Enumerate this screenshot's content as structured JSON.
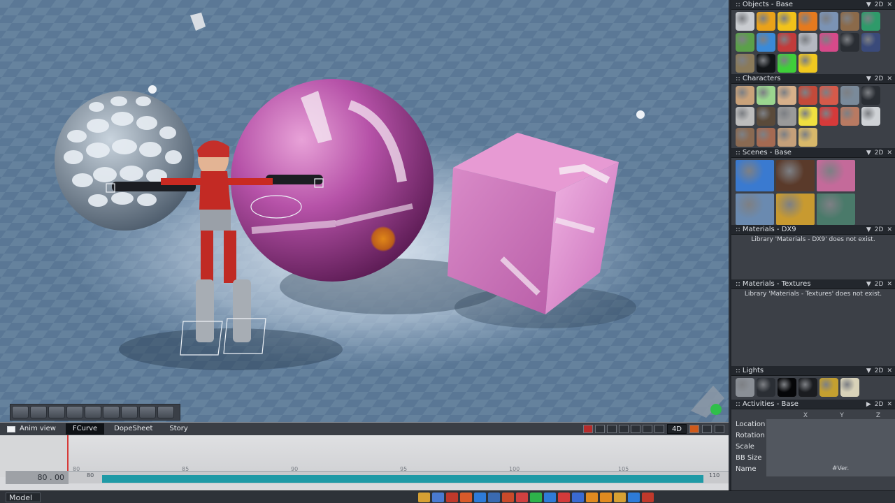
{
  "panels": [
    {
      "title": ":: Objects - Base",
      "controls": [
        "▼",
        "2D",
        "✕"
      ]
    },
    {
      "title": ":: Characters",
      "controls": [
        "▼",
        "2D",
        "✕"
      ]
    },
    {
      "title": ":: Scenes - Base",
      "controls": [
        "▼",
        "2D",
        "✕"
      ]
    },
    {
      "title": ":: Materials - DX9",
      "controls": [
        "▼",
        "2D",
        "✕"
      ],
      "message": "Library 'Materials - DX9' does not exist."
    },
    {
      "title": ":: Materials - Textures",
      "controls": [
        "▼",
        "2D",
        "✕"
      ],
      "message": "Library 'Materials - Textures' does not exist."
    },
    {
      "title": ":: Lights",
      "controls": [
        "▼",
        "2D",
        "✕"
      ]
    },
    {
      "title": ":: Activities - Base",
      "controls": [
        "▶",
        "2D",
        "✕"
      ]
    }
  ],
  "object_colors": [
    "#c9ccd0",
    "#e9a21a",
    "#f2c21a",
    "#e57a1e",
    "#7b93b4",
    "#8b6a4a",
    "#2f9a6a",
    "#5ba04a",
    "#3b8ad8",
    "#c23b3b",
    "#b4b8c0",
    "#d64a8a",
    "#2a2e34",
    "#3a4a7a",
    "#8a7a5a",
    "#111417",
    "#3fcf3a",
    "#f0c820"
  ],
  "character_colors": [
    "#c9a27a",
    "#9bd58f",
    "#d7b08a",
    "#c44a3a",
    "#d65a4a",
    "#7a8a9a",
    "#2a2e34",
    "#bdbdbd",
    "#5a4a3a",
    "#9a9a9a",
    "#f0e040",
    "#d63a3a",
    "#b87a62",
    "#cfd2d6",
    "#8a6a52",
    "#a56a52",
    "#c5a07a",
    "#d8b86a"
  ],
  "scene_colors": [
    "#3a7ad0",
    "#5a3a2a",
    "#c46a9a",
    "#6a8ab0",
    "#c89a30",
    "#4a7a6a"
  ],
  "light_colors": [
    "#8a8f96",
    "#2a2e34",
    "#050608",
    "#1a1c20",
    "#c4a030",
    "#d8d2b8"
  ],
  "timeline": {
    "tabs": [
      "Anim view",
      "FCurve",
      "DopeSheet",
      "Story"
    ],
    "active_tab": "FCurve",
    "mode": "4D",
    "current_frame": "80 . 00",
    "ruler_ticks": [
      "80",
      "85",
      "90",
      "95",
      "100",
      "105",
      "110"
    ],
    "curve_ticks": [
      "80",
      "85",
      "90",
      "95",
      "100",
      "105"
    ]
  },
  "coords": {
    "axes": [
      "X",
      "Y",
      "Z"
    ],
    "rows": [
      "Location",
      "Rotation",
      "Scale",
      "BB Size",
      "Name"
    ],
    "name_value": "#Ver."
  },
  "status": {
    "mode": "Model"
  },
  "status_icon_colors": [
    "#d6a033",
    "#4a7ad0",
    "#c0392b",
    "#d85a2a",
    "#2e7bd8",
    "#3a6ab0",
    "#c94a2a",
    "#d04040",
    "#2db24a",
    "#2e7bd8",
    "#d33a3a",
    "#3a6ad0",
    "#e08a20",
    "#e08a20",
    "#d6a033",
    "#2e7bd8",
    "#c0392b"
  ]
}
